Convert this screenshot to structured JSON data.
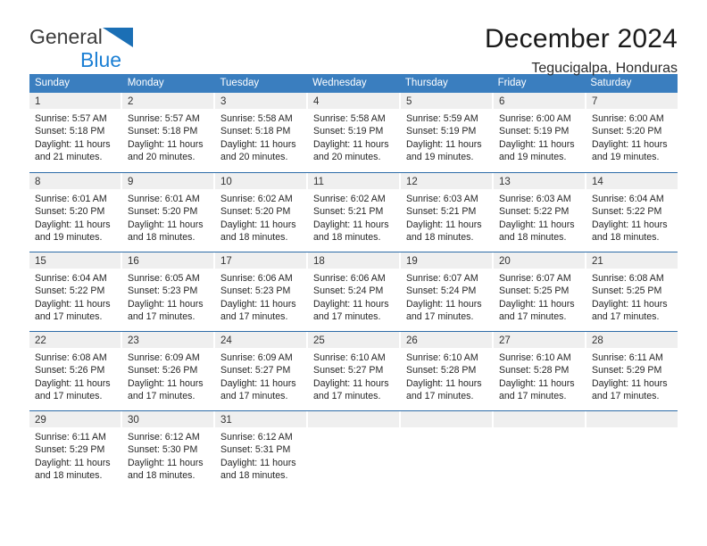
{
  "brand": {
    "name_top": "General",
    "name_bottom": "Blue",
    "mark": "triangle-logo",
    "color_top": "#3c3c3c",
    "color_bottom": "#1b7fd4"
  },
  "header": {
    "title": "December 2024",
    "subtitle": "Tegucigalpa, Honduras"
  },
  "theme": {
    "header_blue": "#3a7ebf",
    "row_rule_blue": "#2d6ca8",
    "day_band_gray": "#efefef"
  },
  "calendar": {
    "weekdays": [
      "Sunday",
      "Monday",
      "Tuesday",
      "Wednesday",
      "Thursday",
      "Friday",
      "Saturday"
    ],
    "weeks": [
      [
        {
          "day": "1",
          "sunrise": "Sunrise: 5:57 AM",
          "sunset": "Sunset: 5:18 PM",
          "daylight1": "Daylight: 11 hours",
          "daylight2": "and 21 minutes."
        },
        {
          "day": "2",
          "sunrise": "Sunrise: 5:57 AM",
          "sunset": "Sunset: 5:18 PM",
          "daylight1": "Daylight: 11 hours",
          "daylight2": "and 20 minutes."
        },
        {
          "day": "3",
          "sunrise": "Sunrise: 5:58 AM",
          "sunset": "Sunset: 5:18 PM",
          "daylight1": "Daylight: 11 hours",
          "daylight2": "and 20 minutes."
        },
        {
          "day": "4",
          "sunrise": "Sunrise: 5:58 AM",
          "sunset": "Sunset: 5:19 PM",
          "daylight1": "Daylight: 11 hours",
          "daylight2": "and 20 minutes."
        },
        {
          "day": "5",
          "sunrise": "Sunrise: 5:59 AM",
          "sunset": "Sunset: 5:19 PM",
          "daylight1": "Daylight: 11 hours",
          "daylight2": "and 19 minutes."
        },
        {
          "day": "6",
          "sunrise": "Sunrise: 6:00 AM",
          "sunset": "Sunset: 5:19 PM",
          "daylight1": "Daylight: 11 hours",
          "daylight2": "and 19 minutes."
        },
        {
          "day": "7",
          "sunrise": "Sunrise: 6:00 AM",
          "sunset": "Sunset: 5:20 PM",
          "daylight1": "Daylight: 11 hours",
          "daylight2": "and 19 minutes."
        }
      ],
      [
        {
          "day": "8",
          "sunrise": "Sunrise: 6:01 AM",
          "sunset": "Sunset: 5:20 PM",
          "daylight1": "Daylight: 11 hours",
          "daylight2": "and 19 minutes."
        },
        {
          "day": "9",
          "sunrise": "Sunrise: 6:01 AM",
          "sunset": "Sunset: 5:20 PM",
          "daylight1": "Daylight: 11 hours",
          "daylight2": "and 18 minutes."
        },
        {
          "day": "10",
          "sunrise": "Sunrise: 6:02 AM",
          "sunset": "Sunset: 5:20 PM",
          "daylight1": "Daylight: 11 hours",
          "daylight2": "and 18 minutes."
        },
        {
          "day": "11",
          "sunrise": "Sunrise: 6:02 AM",
          "sunset": "Sunset: 5:21 PM",
          "daylight1": "Daylight: 11 hours",
          "daylight2": "and 18 minutes."
        },
        {
          "day": "12",
          "sunrise": "Sunrise: 6:03 AM",
          "sunset": "Sunset: 5:21 PM",
          "daylight1": "Daylight: 11 hours",
          "daylight2": "and 18 minutes."
        },
        {
          "day": "13",
          "sunrise": "Sunrise: 6:03 AM",
          "sunset": "Sunset: 5:22 PM",
          "daylight1": "Daylight: 11 hours",
          "daylight2": "and 18 minutes."
        },
        {
          "day": "14",
          "sunrise": "Sunrise: 6:04 AM",
          "sunset": "Sunset: 5:22 PM",
          "daylight1": "Daylight: 11 hours",
          "daylight2": "and 18 minutes."
        }
      ],
      [
        {
          "day": "15",
          "sunrise": "Sunrise: 6:04 AM",
          "sunset": "Sunset: 5:22 PM",
          "daylight1": "Daylight: 11 hours",
          "daylight2": "and 17 minutes."
        },
        {
          "day": "16",
          "sunrise": "Sunrise: 6:05 AM",
          "sunset": "Sunset: 5:23 PM",
          "daylight1": "Daylight: 11 hours",
          "daylight2": "and 17 minutes."
        },
        {
          "day": "17",
          "sunrise": "Sunrise: 6:06 AM",
          "sunset": "Sunset: 5:23 PM",
          "daylight1": "Daylight: 11 hours",
          "daylight2": "and 17 minutes."
        },
        {
          "day": "18",
          "sunrise": "Sunrise: 6:06 AM",
          "sunset": "Sunset: 5:24 PM",
          "daylight1": "Daylight: 11 hours",
          "daylight2": "and 17 minutes."
        },
        {
          "day": "19",
          "sunrise": "Sunrise: 6:07 AM",
          "sunset": "Sunset: 5:24 PM",
          "daylight1": "Daylight: 11 hours",
          "daylight2": "and 17 minutes."
        },
        {
          "day": "20",
          "sunrise": "Sunrise: 6:07 AM",
          "sunset": "Sunset: 5:25 PM",
          "daylight1": "Daylight: 11 hours",
          "daylight2": "and 17 minutes."
        },
        {
          "day": "21",
          "sunrise": "Sunrise: 6:08 AM",
          "sunset": "Sunset: 5:25 PM",
          "daylight1": "Daylight: 11 hours",
          "daylight2": "and 17 minutes."
        }
      ],
      [
        {
          "day": "22",
          "sunrise": "Sunrise: 6:08 AM",
          "sunset": "Sunset: 5:26 PM",
          "daylight1": "Daylight: 11 hours",
          "daylight2": "and 17 minutes."
        },
        {
          "day": "23",
          "sunrise": "Sunrise: 6:09 AM",
          "sunset": "Sunset: 5:26 PM",
          "daylight1": "Daylight: 11 hours",
          "daylight2": "and 17 minutes."
        },
        {
          "day": "24",
          "sunrise": "Sunrise: 6:09 AM",
          "sunset": "Sunset: 5:27 PM",
          "daylight1": "Daylight: 11 hours",
          "daylight2": "and 17 minutes."
        },
        {
          "day": "25",
          "sunrise": "Sunrise: 6:10 AM",
          "sunset": "Sunset: 5:27 PM",
          "daylight1": "Daylight: 11 hours",
          "daylight2": "and 17 minutes."
        },
        {
          "day": "26",
          "sunrise": "Sunrise: 6:10 AM",
          "sunset": "Sunset: 5:28 PM",
          "daylight1": "Daylight: 11 hours",
          "daylight2": "and 17 minutes."
        },
        {
          "day": "27",
          "sunrise": "Sunrise: 6:10 AM",
          "sunset": "Sunset: 5:28 PM",
          "daylight1": "Daylight: 11 hours",
          "daylight2": "and 17 minutes."
        },
        {
          "day": "28",
          "sunrise": "Sunrise: 6:11 AM",
          "sunset": "Sunset: 5:29 PM",
          "daylight1": "Daylight: 11 hours",
          "daylight2": "and 17 minutes."
        }
      ],
      [
        {
          "day": "29",
          "sunrise": "Sunrise: 6:11 AM",
          "sunset": "Sunset: 5:29 PM",
          "daylight1": "Daylight: 11 hours",
          "daylight2": "and 18 minutes."
        },
        {
          "day": "30",
          "sunrise": "Sunrise: 6:12 AM",
          "sunset": "Sunset: 5:30 PM",
          "daylight1": "Daylight: 11 hours",
          "daylight2": "and 18 minutes."
        },
        {
          "day": "31",
          "sunrise": "Sunrise: 6:12 AM",
          "sunset": "Sunset: 5:31 PM",
          "daylight1": "Daylight: 11 hours",
          "daylight2": "and 18 minutes."
        },
        {
          "day": "",
          "sunrise": "",
          "sunset": "",
          "daylight1": "",
          "daylight2": ""
        },
        {
          "day": "",
          "sunrise": "",
          "sunset": "",
          "daylight1": "",
          "daylight2": ""
        },
        {
          "day": "",
          "sunrise": "",
          "sunset": "",
          "daylight1": "",
          "daylight2": ""
        },
        {
          "day": "",
          "sunrise": "",
          "sunset": "",
          "daylight1": "",
          "daylight2": ""
        }
      ]
    ]
  }
}
